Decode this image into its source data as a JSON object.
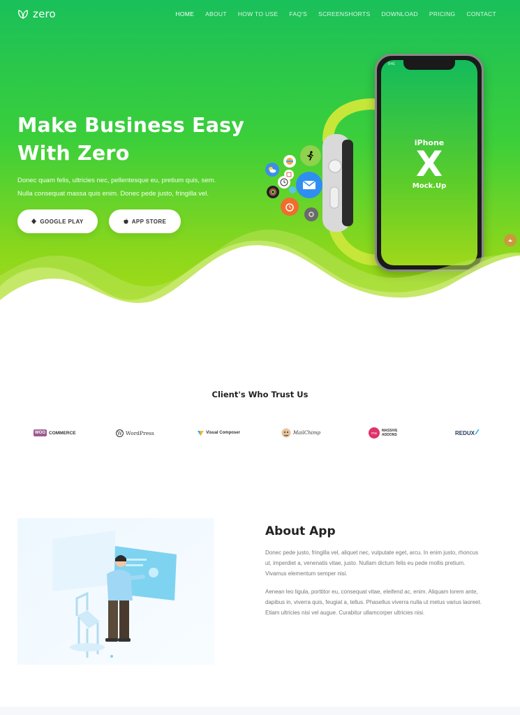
{
  "nav": {
    "logo_text": "zero",
    "items": [
      {
        "label": "HOME",
        "active": true
      },
      {
        "label": "ABOUT"
      },
      {
        "label": "HOW TO USE"
      },
      {
        "label": "FAQ'S"
      },
      {
        "label": "SCREENSHORTS"
      },
      {
        "label": "DOWNLOAD"
      },
      {
        "label": "PRICING"
      },
      {
        "label": "CONTACT"
      }
    ]
  },
  "hero": {
    "title_line1": "Make Business Easy",
    "title_line2": "With Zero",
    "desc_line1": "Donec quam felis, ultricies nec, pellentesque eu, pretium quis, sem.",
    "desc_line2": "Nulla consequat massa quis enim. Donec pede justo, fringilla vel.",
    "google_play_label": "GOOGLE PLAY",
    "app_store_label": "APP STORE",
    "phone": {
      "status_time": "9:41",
      "model_line1": "iPhone",
      "model_line2": "X",
      "model_line3": "Mock.Up"
    }
  },
  "clients": {
    "title": "Client's Who Trust Us",
    "logos": [
      {
        "name": "woocommerce",
        "badge": "WOO",
        "text": "COMMERCE"
      },
      {
        "name": "wordpress",
        "text": "WordPress"
      },
      {
        "name": "visual-composer",
        "text": "Visual Composer"
      },
      {
        "name": "mailchimp",
        "text": "MailChimp"
      },
      {
        "name": "massive-addons",
        "text_line1": "MASSIVE",
        "text_line2": "ADDONS"
      },
      {
        "name": "redux",
        "text": "REDUX"
      }
    ]
  },
  "about": {
    "title": "About App",
    "p1": [
      "Donec pede justo, fringilla vel, aliquet nec, vulputate eget, arcu. In enim justo, rhoncus",
      "ut, imperdiet a, venenatis vitae, justo. Nullam dictum felis eu pede mollis pretium.",
      "Vivamus elementum semper nisi."
    ],
    "p2": [
      "Aenean leo ligula, porttitor eu, consequat vitae, eleifend ac, enim. Aliquam lorem ante,",
      "dapibus in, viverra quis, feugiat a, tellus. Phasellus viverra nulla ut metus varius laoreet.",
      "Etiam ultricies nisi vel augue. Curabitur ullamcorper ultricies nisi."
    ]
  },
  "colors": {
    "hero_top": "#19c05a",
    "hero_bottom": "#a9dc17",
    "scroll_top_button": "#c99a3c",
    "heading_text": "#222222",
    "body_text": "#777777"
  },
  "icons": {
    "logo": "leaf-logo-icon",
    "google_play": "android-icon",
    "app_store": "apple-icon",
    "scroll_top": "chevron-up-icon"
  }
}
